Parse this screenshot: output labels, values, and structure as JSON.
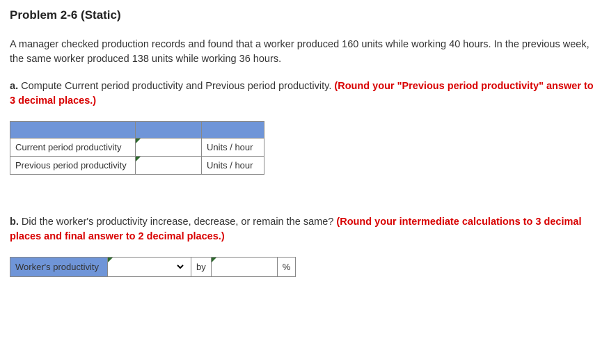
{
  "title": "Problem 2-6 (Static)",
  "intro": "A manager checked production records and found that a worker produced 160 units while working 40 hours. In the previous week, the same worker produced 138 units while working 36 hours.",
  "partA": {
    "prefix": "a.",
    "text": " Compute Current period productivity and Previous period productivity. ",
    "emphasis": "(Round your \"Previous period productivity\" answer to 3 decimal places.)",
    "rows": [
      {
        "label": "Current period productivity",
        "unit": "Units / hour"
      },
      {
        "label": "Previous period productivity",
        "unit": "Units / hour"
      }
    ]
  },
  "partB": {
    "prefix": "b.",
    "text": " Did the worker's productivity increase, decrease, or remain the same? ",
    "emphasis": "(Round your intermediate calculations to 3 decimal places and final answer to 2 decimal places.)",
    "label": "Worker's productivity",
    "by": "by",
    "pct": "%"
  }
}
